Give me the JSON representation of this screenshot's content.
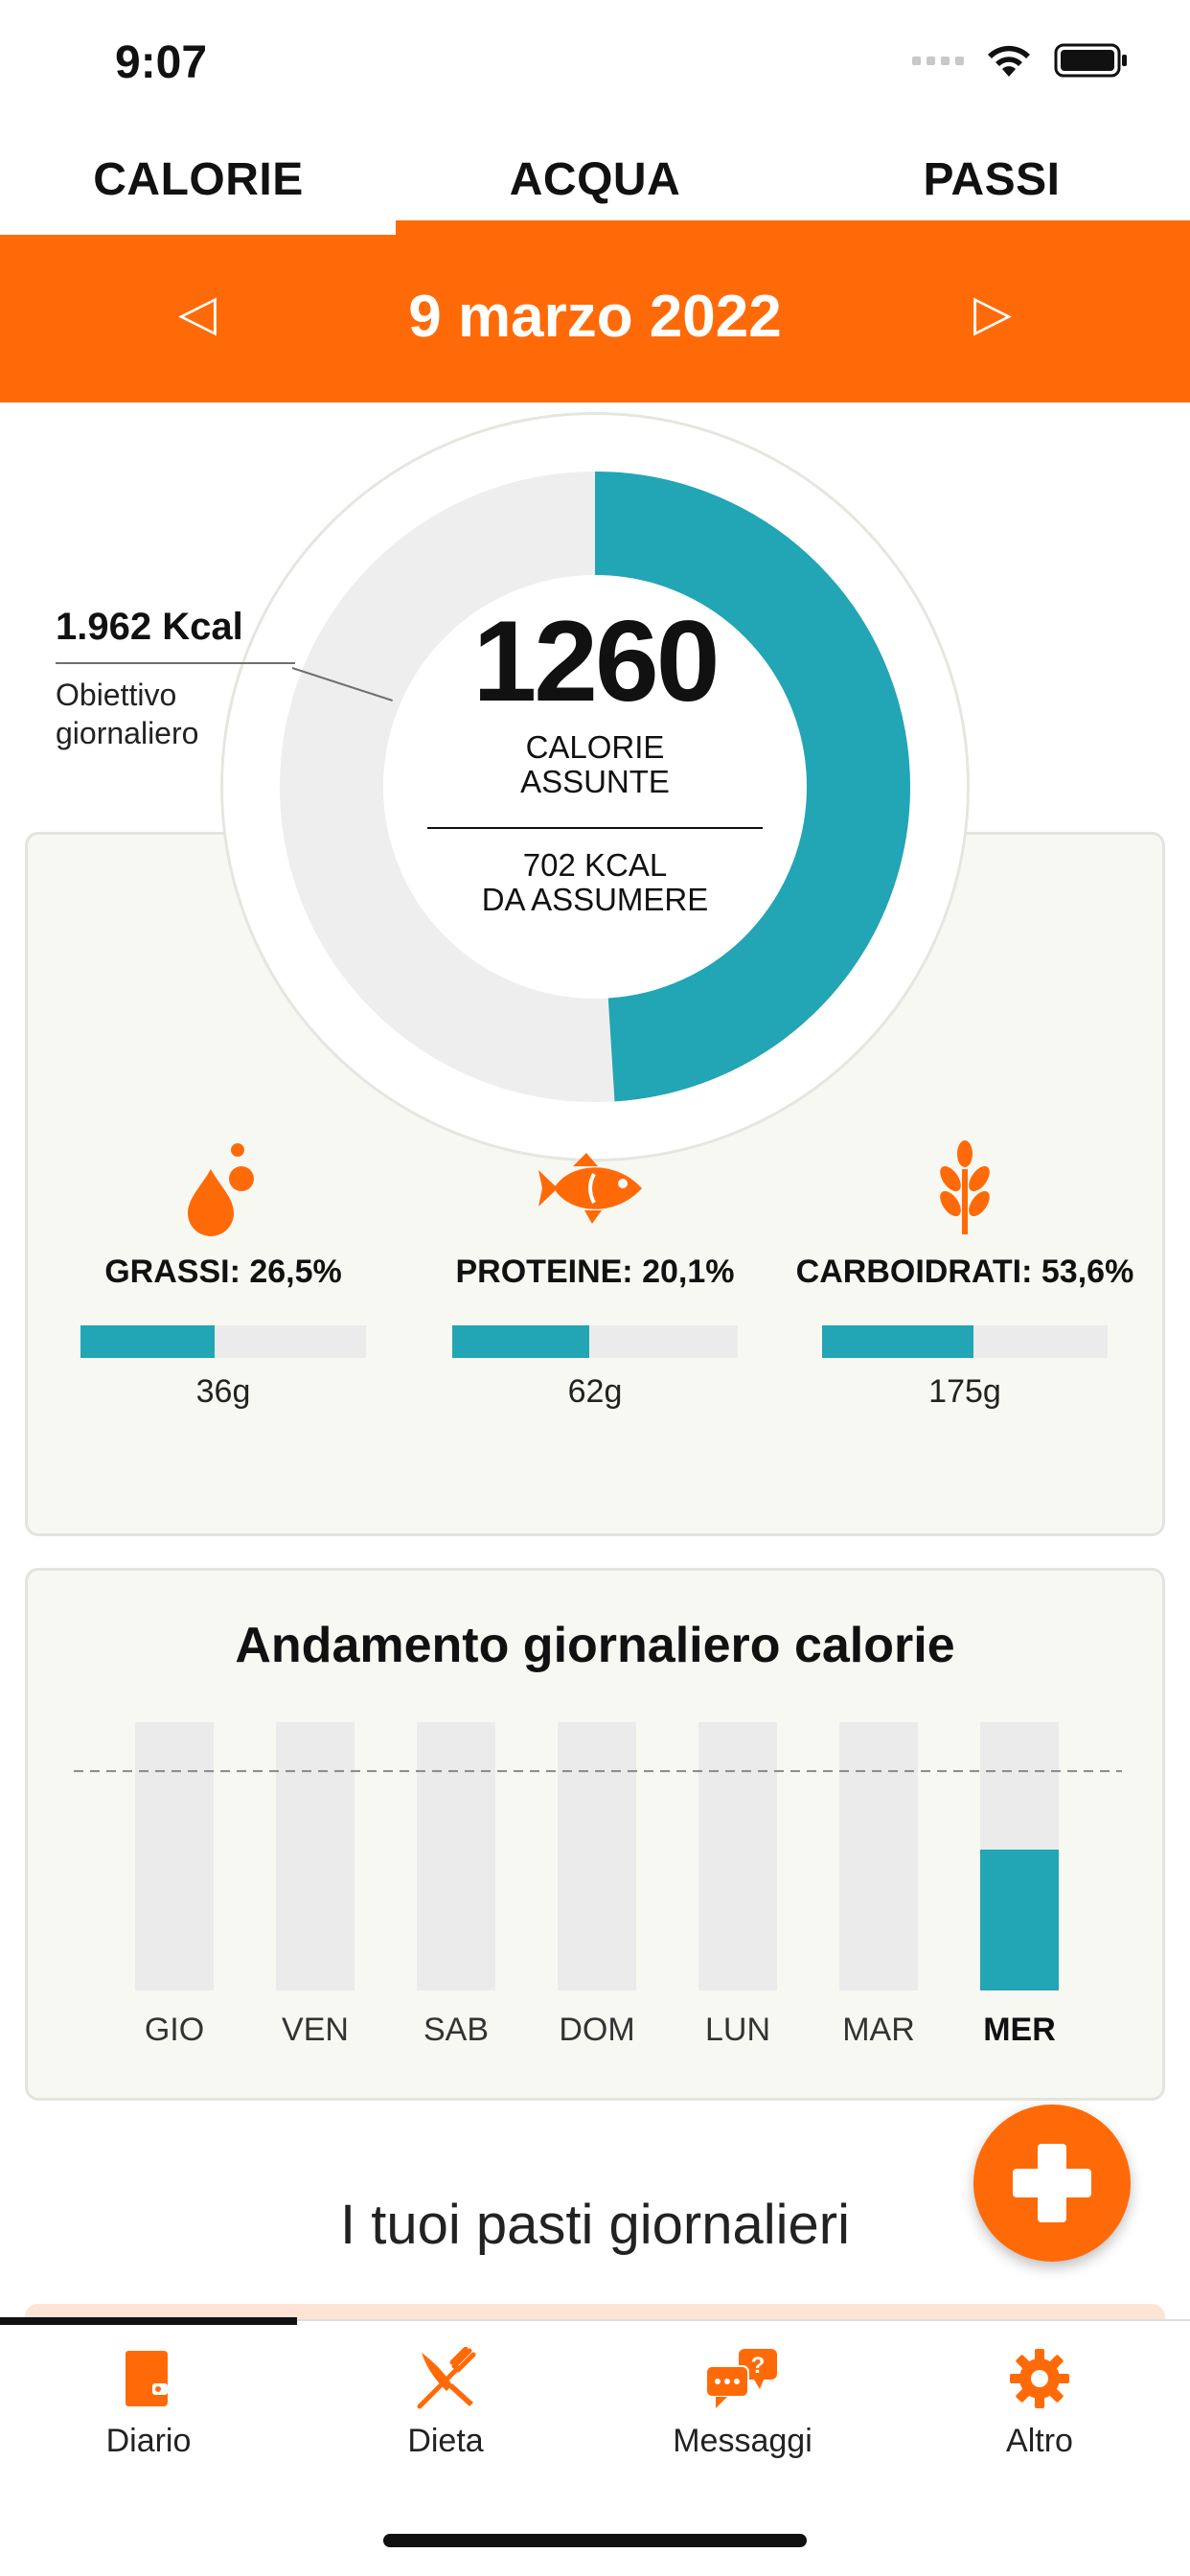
{
  "status_bar": {
    "time": "9:07"
  },
  "tabs": [
    {
      "label": "CALORIE",
      "active": true
    },
    {
      "label": "ACQUA",
      "active": false
    },
    {
      "label": "PASSI",
      "active": false
    }
  ],
  "date_nav": {
    "date": "9 marzo 2022",
    "prev_icon": "triangle-left-icon",
    "next_icon": "triangle-right-icon"
  },
  "summary": {
    "consumed_value": "1260",
    "consumed_label_line1": "CALORIE",
    "consumed_label_line2": "ASSUNTE",
    "remaining_line1": "702 KCAL",
    "remaining_line2": "DA ASSUMERE",
    "goal_value": "1.962 Kcal",
    "goal_label_line1": "Obiettivo",
    "goal_label_line2": "giornaliero",
    "progress_fraction": 0.49,
    "ring_color": "#22a5b4",
    "ring_track_color": "#eeeeee"
  },
  "macros": [
    {
      "label": "GRASSI: 26,5%",
      "grams": "36g",
      "fill_fraction": 0.47,
      "icon": "drop-icon"
    },
    {
      "label": "PROTEINE: 20,1%",
      "grams": "62g",
      "fill_fraction": 0.48,
      "icon": "fish-icon"
    },
    {
      "label": "CARBOIDRATI: 53,6%",
      "grams": "175g",
      "fill_fraction": 0.53,
      "icon": "wheat-icon"
    }
  ],
  "chart_data": {
    "type": "bar",
    "title": "Andamento giornaliero calorie",
    "categories": [
      "GIO",
      "VEN",
      "SAB",
      "DOM",
      "LUN",
      "MAR",
      "MER"
    ],
    "values": [
      0,
      0,
      0,
      0,
      0,
      0,
      1260
    ],
    "ylim": [
      0,
      2400
    ],
    "goal_line": 1962,
    "highlighted_category": "MER",
    "bar_color": "#22a5b4",
    "track_color": "#ebebeb"
  },
  "meals": {
    "title": "I tuoi pasti giornalieri"
  },
  "fab": {
    "icon": "plus-icon"
  },
  "bottom_nav": [
    {
      "label": "Diario",
      "icon": "diary-icon",
      "active": true
    },
    {
      "label": "Dieta",
      "icon": "fork-knife-icon",
      "active": false
    },
    {
      "label": "Messaggi",
      "icon": "chat-icon",
      "active": false
    },
    {
      "label": "Altro",
      "icon": "gear-icon",
      "active": false
    }
  ],
  "colors": {
    "accent": "#ff6a09",
    "teal": "#22a5b4",
    "card_bg": "#f8f8f3"
  }
}
